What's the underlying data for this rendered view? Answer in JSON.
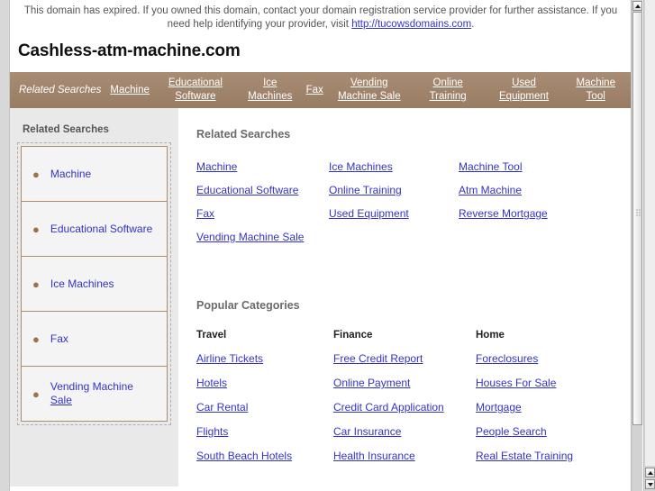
{
  "banner": {
    "text_before": "This domain has expired. If you owned this domain, contact your domain registration service provider for further assistance. If you need help identifying your provider, visit ",
    "link_text": "http://tucowsdomains.com",
    "text_after": "."
  },
  "header": {
    "domain_title": "Cashless-atm-machine.com"
  },
  "navbar": {
    "label": "Related Searches",
    "items": [
      {
        "label": "Machine"
      },
      {
        "label": "Educational Software"
      },
      {
        "label": "Ice Machines"
      },
      {
        "label": "Fax"
      },
      {
        "label": "Vending Machine Sale"
      },
      {
        "label": "Online Training"
      },
      {
        "label": "Used Equipment"
      },
      {
        "label": "Machine Tool"
      }
    ]
  },
  "sidebar": {
    "title": "Related Searches",
    "items": [
      {
        "label": "Machine"
      },
      {
        "label": "Educational Software"
      },
      {
        "label": "Ice Machines"
      },
      {
        "label": "Fax"
      },
      {
        "label_line1": "Vending Machine",
        "label_line2": "Sale"
      }
    ]
  },
  "main": {
    "related_title": "Related Searches",
    "related_links": [
      "Machine",
      "Ice Machines",
      "Machine Tool",
      "Educational Software",
      "Online Training",
      "Atm Machine",
      "Fax",
      "Used Equipment",
      "Reverse Mortgage",
      "Vending Machine Sale",
      "",
      ""
    ],
    "categories_title": "Popular Categories",
    "category_headers": [
      "Travel",
      "Finance",
      "Home"
    ],
    "category_rows": [
      [
        "Airline Tickets",
        "Free Credit Report",
        "Foreclosures"
      ],
      [
        "Hotels",
        "Online Payment",
        "Houses For Sale"
      ],
      [
        "Car Rental",
        "Credit Card Application",
        "Mortgage"
      ],
      [
        "Flights",
        "Car Insurance",
        "People Search"
      ],
      [
        "South Beach Hotels",
        "Health Insurance",
        "Real Estate Training"
      ]
    ]
  },
  "colors": {
    "nav_background": "#a0836b",
    "link": "#3333cc",
    "bullet": "#9c7249",
    "sidebar_background": "#e9e9e9",
    "cell_border": "#b08b6a"
  }
}
